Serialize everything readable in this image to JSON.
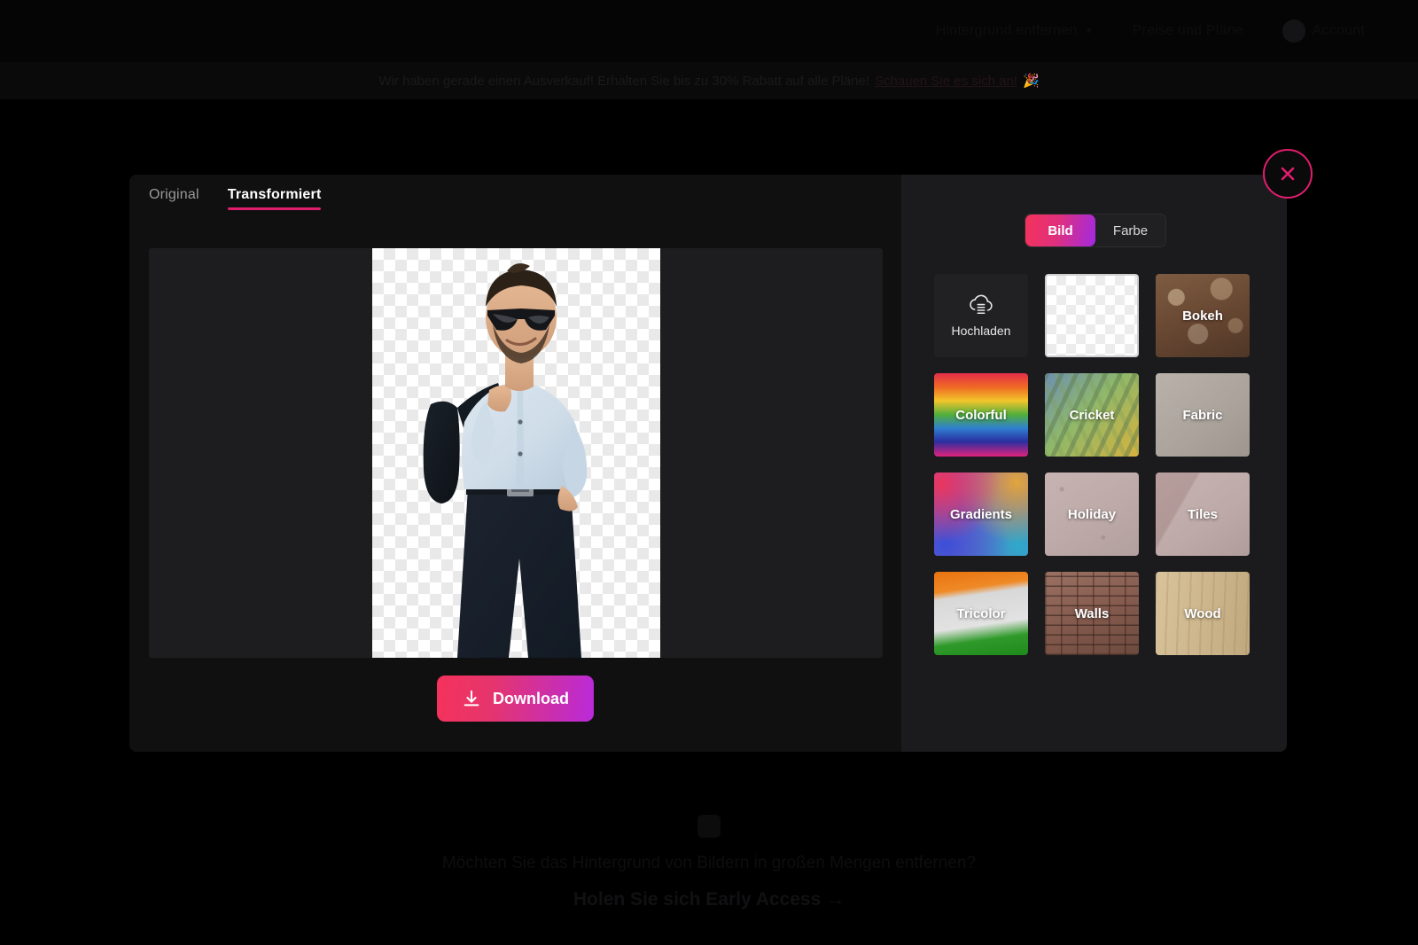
{
  "topbar": {
    "items": [
      {
        "label": "Hintergrund entfernen",
        "icon": "chevron-down-icon"
      },
      {
        "label": "Preise und Pläne"
      }
    ],
    "avatar_label": "Account"
  },
  "promo": {
    "text": "Wir haben gerade einen Ausverkauf! Erhalten Sie bis zu 30% Rabatt auf alle Pläne!",
    "link_text": "Schauen Sie es sich an!",
    "emoji": "🎉"
  },
  "modal": {
    "tabs": [
      {
        "label": "Original",
        "active": false
      },
      {
        "label": "Transformiert",
        "active": true
      }
    ],
    "preview": {
      "alt": "Mann mit Sonnenbrille, hellblauem Hemd und Jackett über der Schulter auf transparentem Hintergrund"
    },
    "download": {
      "label": "Download",
      "icon": "download-icon"
    },
    "close": {
      "label": "Schließen",
      "icon": "close-icon"
    },
    "panel": {
      "segments": [
        {
          "label": "Bild",
          "active": true
        },
        {
          "label": "Farbe",
          "active": false
        }
      ],
      "swatches": [
        {
          "label": "Hochladen",
          "kind": "upload",
          "icon": "cloud-upload-icon"
        },
        {
          "label": "Transparent",
          "kind": "transparent",
          "selected": true
        },
        {
          "label": "Bokeh",
          "kind": "texture"
        },
        {
          "label": "Colorful",
          "kind": "texture"
        },
        {
          "label": "Cricket",
          "kind": "texture"
        },
        {
          "label": "Fabric",
          "kind": "texture"
        },
        {
          "label": "Gradients",
          "kind": "texture"
        },
        {
          "label": "Holiday",
          "kind": "texture"
        },
        {
          "label": "Tiles",
          "kind": "texture"
        },
        {
          "label": "Tricolor",
          "kind": "texture"
        },
        {
          "label": "Walls",
          "kind": "texture"
        },
        {
          "label": "Wood",
          "kind": "texture"
        }
      ]
    }
  },
  "bottom": {
    "headline": "Möchten Sie das Hintergrund von Bildern in großen Mengen entfernen?",
    "cta": "Holen Sie sich Early Access →"
  },
  "colors": {
    "accent_pink": "#e11d6e",
    "gradient_start": "#f5325b",
    "gradient_end": "#a22ae0",
    "modal_bg": "#111112",
    "panel_bg": "#1b1b1d",
    "preview_bg": "#1d1d1f"
  }
}
